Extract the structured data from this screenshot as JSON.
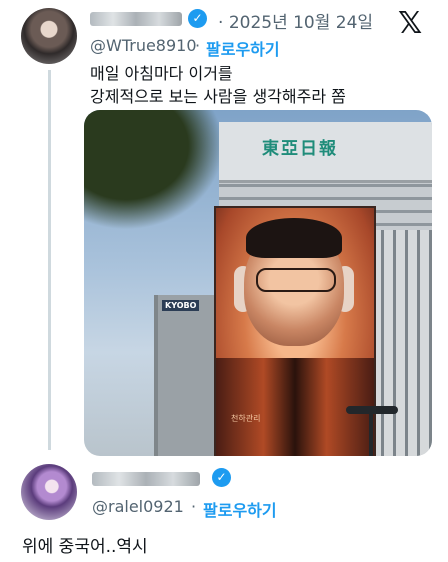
{
  "first_tweet": {
    "date": "2025년 10월 24일",
    "handle": "@WTrue8910",
    "separator": "·",
    "follow_label": "팔로우하기",
    "text_line1": "매일 아침마다 이거를",
    "text_line2": "강제적으로 보는 사람을 생각해주라 쫌",
    "media_sign": "東亞日報",
    "kyobo_label": "KYOBO",
    "billboard_caption": "천하관리"
  },
  "second_tweet": {
    "handle": "@ralel0921",
    "separator": "·",
    "follow_label": "팔로우하기",
    "text": "위에 중국어..역시"
  },
  "header": {
    "platform_logo": "𝕏"
  },
  "icons": {
    "verified": "verified-badge-icon",
    "platform": "x-logo-icon"
  },
  "colors": {
    "accent": "#1d9bf0",
    "secondary_text": "#536471"
  }
}
